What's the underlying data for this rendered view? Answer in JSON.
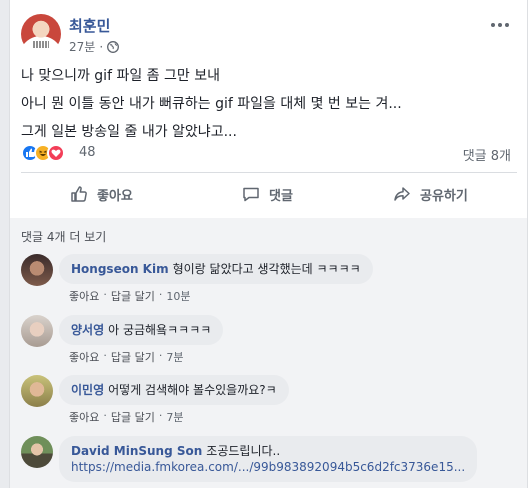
{
  "post": {
    "author": "최훈민",
    "time": "27분",
    "lines": [
      "나 맞으니까 gif 파일 좀 그만 보내",
      "아니 뭔 이틀 동안 내가 뻐큐하는 gif 파일을 대체 몇 번 보는 겨...",
      "그게 일본 방송일 줄 내가 알았냐고..."
    ],
    "reaction_count": "48",
    "comment_count": "댓글 8개",
    "reaction_icons": [
      "like-icon",
      "haha-icon",
      "love-icon"
    ]
  },
  "actions": {
    "like": "좋아요",
    "comment": "댓글",
    "share": "공유하기"
  },
  "comments_section": {
    "more_label": "댓글 4개 더 보기",
    "items": [
      {
        "name": "Hongseon Kim",
        "text": "형이랑 닮았다고 생각했는데 ㅋㅋㅋㅋ",
        "like": "좋아요",
        "reply": "답글 달기",
        "time": "10분"
      },
      {
        "name": "양서영",
        "text": "아 궁금해욬ㅋㅋㅋㅋ",
        "like": "좋아요",
        "reply": "답글 달기",
        "time": "7분"
      },
      {
        "name": "이민영",
        "text": "어떻게 검색해야 볼수있을까요?ㅋ",
        "like": "좋아요",
        "reply": "답글 달기",
        "time": "7분"
      },
      {
        "name": "David MinSung Son",
        "text": "조공드립니다..",
        "link": "https://media.fmkorea.com/.../99b983892094b5c6d2fc3736e15..."
      }
    ]
  },
  "colors": {
    "link_blue": "#385898",
    "like_blue": "#1877f2",
    "haha_yellow": "#f7b125",
    "love_red": "#f33e58"
  }
}
